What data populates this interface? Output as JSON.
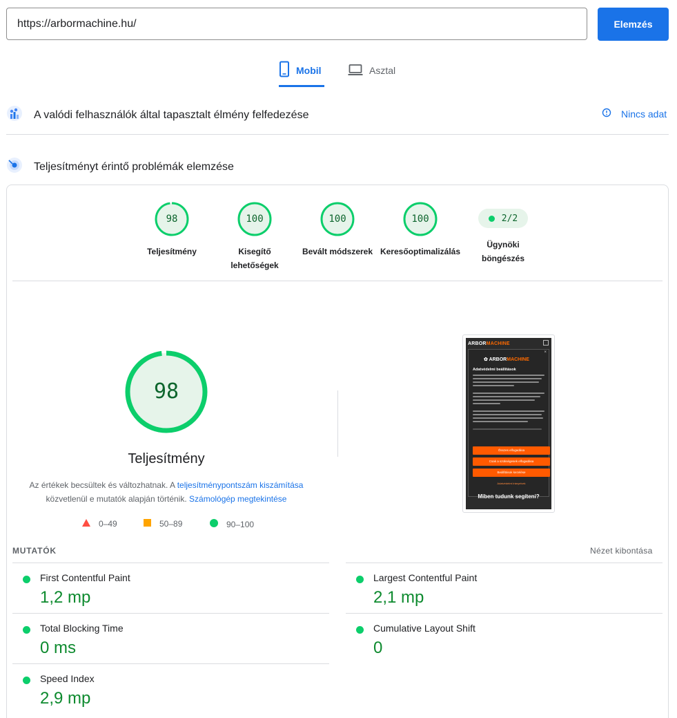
{
  "search": {
    "url_value": "https://arbormachine.hu/",
    "analyze_label": "Elemzés"
  },
  "device_tabs": {
    "mobile_label": "Mobil",
    "desktop_label": "Asztal"
  },
  "crux_section": {
    "title": "A valódi felhasználók által tapasztalt élmény felfedezése",
    "no_data_label": "Nincs adat"
  },
  "perf_section": {
    "title": "Teljesítményt érintő problémák elemzése"
  },
  "categories": [
    {
      "score": "98",
      "label": "Teljesítmény"
    },
    {
      "score": "100",
      "label": "Kisegítő lehetőségek"
    },
    {
      "score": "100",
      "label": "Bevált módszerek"
    },
    {
      "score": "100",
      "label": "Keresőoptimalizálás"
    }
  ],
  "agent": {
    "value": "2/2",
    "label": "Ügynöki böngészés"
  },
  "main_score": {
    "score": "98",
    "title": "Teljesítmény",
    "disclaimer_prefix": "Az értékek becsültek és változhatnak. A",
    "disclaimer_link1": "teljesítménypontszám kiszámítása",
    "disclaimer_middle": "közvetlenül e mutatók alapján történik.",
    "disclaimer_link2": "Számológép megtekintése"
  },
  "legend": {
    "fail": "0–49",
    "average": "50–89",
    "pass": "90–100"
  },
  "screenshot": {
    "brand_a": "ARBOR",
    "brand_b": "MACHINE",
    "close": "×",
    "heading": "Adatvédelmi beállítások",
    "buttons": [
      "Összes elfogadása",
      "Csak a szükségesek elfogadása",
      "Beállítások kezelése"
    ],
    "link": "Adatvédelmi irányelvek",
    "footer": "Miben tudunk segíteni?"
  },
  "metrics": {
    "title": "MUTATÓK",
    "expand_label": "Nézet kibontása",
    "fcp": {
      "name": "First Contentful Paint",
      "value": "1,2 mp"
    },
    "lcp": {
      "name": "Largest Contentful Paint",
      "value": "2,1 mp"
    },
    "tbt": {
      "name": "Total Blocking Time",
      "value": "0 ms"
    },
    "cls": {
      "name": "Cumulative Layout Shift",
      "value": "0"
    },
    "si": {
      "name": "Speed Index",
      "value": "2,9 mp"
    }
  },
  "colors": {
    "accent": "#1a73e8",
    "pass": "#0cce6b",
    "pass_text": "#0d652d",
    "average": "#ffa400",
    "fail": "#ff4e42"
  }
}
